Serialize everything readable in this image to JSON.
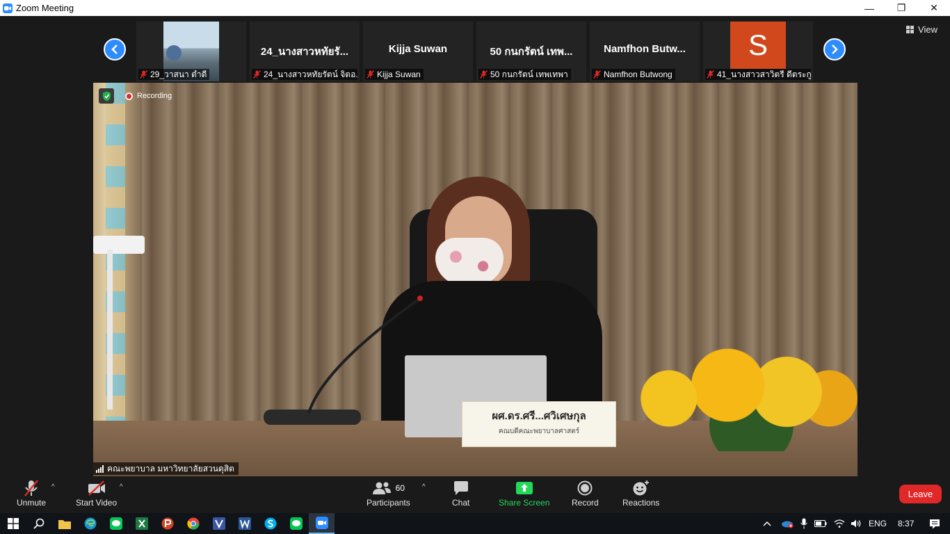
{
  "window": {
    "title": "Zoom Meeting",
    "minimize": "—",
    "restore": "❐",
    "close": "✕"
  },
  "strip": {
    "participants": [
      {
        "display": "",
        "label": "29_วาสนา ดำดี",
        "muted": true,
        "has_video": true
      },
      {
        "display": "24_นางสาวหทัยรั...",
        "label": "24_นางสาวหทัยรัตน์ จิตอ...",
        "muted": true
      },
      {
        "display": "Kijja Suwan",
        "label": "Kijja Suwan",
        "muted": true
      },
      {
        "display": "50 กนกรัตน์ เทพ...",
        "label": "50 กนกรัตน์ เทพเทพา",
        "muted": true
      },
      {
        "display": "Namfhon  Butw...",
        "label": "Namfhon Butwong",
        "muted": true
      },
      {
        "display": "S",
        "label": "41_นางสาวสาวิตรี ดีตระกู...",
        "muted": true,
        "avatar_color": "#d2481d"
      }
    ],
    "view_label": "View"
  },
  "main": {
    "recording_label": "Recording",
    "speaker_name": "คณะพยาบาล มหาวิทยาลัยสวนดุสิต",
    "nameplate_line1": "ผศ.ดร.ศรี...ศวิเศษกุล",
    "nameplate_line2": "คณบดีคณะพยาบาลศาสตร์"
  },
  "toolbar": {
    "unmute": "Unmute",
    "start_video": "Start Video",
    "participants": "Participants",
    "participants_count": "60",
    "chat": "Chat",
    "share_screen": "Share Screen",
    "record": "Record",
    "reactions": "Reactions",
    "leave": "Leave",
    "share_color": "#23d959"
  },
  "taskbar": {
    "apps": [
      "start",
      "search",
      "file-explorer",
      "edge",
      "line",
      "excel",
      "powerpoint",
      "chrome",
      "visio",
      "word",
      "skype",
      "line",
      "zoom"
    ],
    "language": "ENG",
    "time": "8:37"
  }
}
